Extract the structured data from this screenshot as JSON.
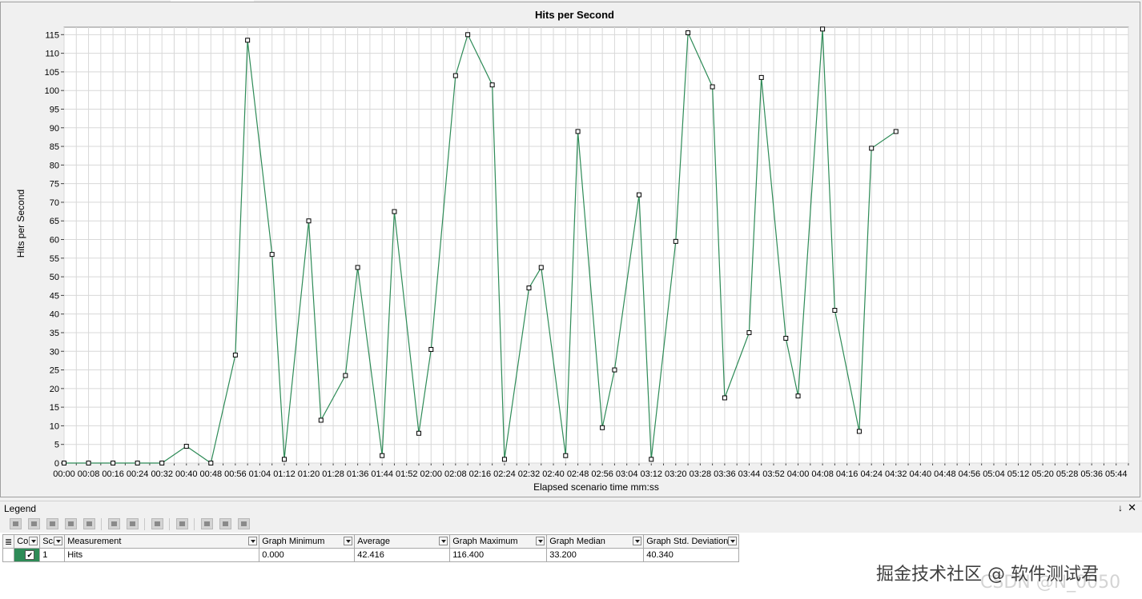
{
  "chart_data": {
    "type": "line",
    "title": "Hits per Second",
    "xlabel": "Elapsed scenario time mm:ss",
    "ylabel": "Hits per Second",
    "ylim": [
      0,
      117
    ],
    "yticks": [
      0,
      5,
      10,
      15,
      20,
      25,
      30,
      35,
      40,
      45,
      50,
      55,
      60,
      65,
      70,
      75,
      80,
      85,
      90,
      95,
      100,
      105,
      110,
      115
    ],
    "x": [
      "00:00",
      "00:04",
      "00:08",
      "00:12",
      "00:16",
      "00:20",
      "00:24",
      "00:28",
      "00:32",
      "00:36",
      "00:40",
      "00:44",
      "00:48",
      "00:52",
      "00:56",
      "01:00",
      "01:04",
      "01:08",
      "01:12",
      "01:16",
      "01:20",
      "01:24",
      "01:28",
      "01:32",
      "01:36",
      "01:40",
      "01:44",
      "01:48",
      "01:52",
      "01:56",
      "02:00",
      "02:04",
      "02:08",
      "02:12",
      "02:16",
      "02:20",
      "02:24",
      "02:28",
      "02:32",
      "02:36",
      "02:40",
      "02:44",
      "02:48",
      "02:52",
      "02:56",
      "03:00",
      "03:04",
      "03:08",
      "03:12",
      "03:16",
      "03:20",
      "03:24",
      "03:28",
      "03:32",
      "03:36",
      "03:40",
      "03:44",
      "03:48",
      "03:52",
      "03:56",
      "04:00",
      "04:04",
      "04:08",
      "04:12",
      "04:16",
      "04:20",
      "04:24",
      "04:28",
      "04:32",
      "04:36",
      "04:40",
      "04:44",
      "04:48",
      "04:52",
      "04:56",
      "05:00",
      "05:04",
      "05:08",
      "05:12",
      "05:16",
      "05:20",
      "05:24",
      "05:28",
      "05:32",
      "05:36",
      "05:40",
      "05:44",
      "05:48"
    ],
    "xticks": [
      "00:00",
      "00:08",
      "00:16",
      "00:24",
      "00:32",
      "00:40",
      "00:48",
      "00:56",
      "01:04",
      "01:12",
      "01:20",
      "01:28",
      "01:36",
      "01:44",
      "01:52",
      "02:00",
      "02:08",
      "02:16",
      "02:24",
      "02:32",
      "02:40",
      "02:48",
      "02:56",
      "03:04",
      "03:12",
      "03:20",
      "03:28",
      "03:36",
      "03:44",
      "03:52",
      "04:00",
      "04:08",
      "04:16",
      "04:24",
      "04:32",
      "04:40",
      "04:48",
      "04:56",
      "05:04",
      "05:12",
      "05:20",
      "05:28",
      "05:36",
      "05:44"
    ],
    "series": [
      {
        "name": "Hits",
        "color": "#2e8b57",
        "points": [
          [
            "00:00",
            0
          ],
          [
            "00:08",
            0
          ],
          [
            "00:16",
            0
          ],
          [
            "00:24",
            0
          ],
          [
            "00:32",
            0
          ],
          [
            "00:40",
            4.5
          ],
          [
            "00:48",
            0
          ],
          [
            "00:56",
            29
          ],
          [
            "01:00",
            113.5
          ],
          [
            "01:08",
            56
          ],
          [
            "01:12",
            1
          ],
          [
            "01:20",
            65
          ],
          [
            "01:24",
            11.5
          ],
          [
            "01:32",
            23.5
          ],
          [
            "01:36",
            52.5
          ],
          [
            "01:44",
            2
          ],
          [
            "01:48",
            67.5
          ],
          [
            "01:56",
            8
          ],
          [
            "02:00",
            30.5
          ],
          [
            "02:08",
            104
          ],
          [
            "02:12",
            115
          ],
          [
            "02:20",
            101.5
          ],
          [
            "02:24",
            1
          ],
          [
            "02:32",
            47
          ],
          [
            "02:36",
            52.5
          ],
          [
            "02:44",
            2
          ],
          [
            "02:48",
            89
          ],
          [
            "02:56",
            9.5
          ],
          [
            "03:00",
            25
          ],
          [
            "03:08",
            72
          ],
          [
            "03:12",
            1
          ],
          [
            "03:20",
            59.5
          ],
          [
            "03:24",
            115.5
          ],
          [
            "03:32",
            101
          ],
          [
            "03:36",
            17.5
          ],
          [
            "03:44",
            35
          ],
          [
            "03:48",
            103.5
          ],
          [
            "03:56",
            33.5
          ],
          [
            "04:00",
            18
          ],
          [
            "04:08",
            116.5
          ],
          [
            "04:12",
            41
          ],
          [
            "04:20",
            8.5
          ],
          [
            "04:24",
            84.5
          ],
          [
            "04:32",
            89
          ]
        ]
      }
    ]
  },
  "legend": {
    "title": "Legend",
    "pin_glyph": "↓",
    "close_glyph": "✕",
    "columns": [
      "Col",
      "Sca",
      "Measurement",
      "Graph Minimum",
      "Average",
      "Graph Maximum",
      "Graph Median",
      "Graph Std. Deviation"
    ],
    "row": {
      "color": "#2e8b57",
      "checked": "✔",
      "scale": "1",
      "measurement": "Hits",
      "min": "0.000",
      "avg": "42.416",
      "max": "116.400",
      "median": "33.200",
      "std": "40.340"
    }
  },
  "watermark": {
    "text": "掘金技术社区 @ 软件测试君",
    "sub": "CSDN @N_0050"
  }
}
